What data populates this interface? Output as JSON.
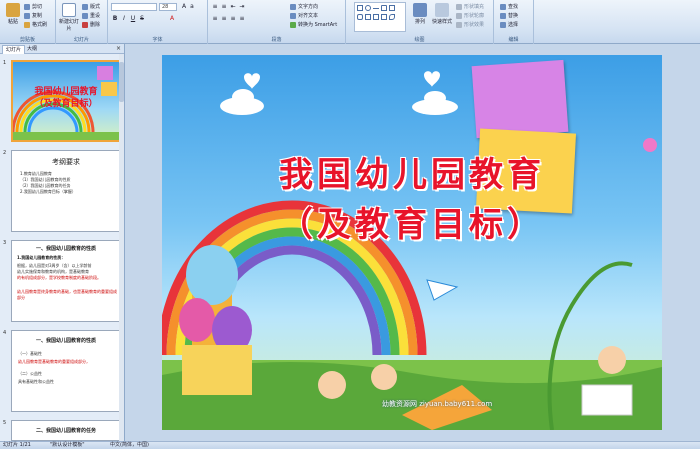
{
  "ribbon": {
    "groups": {
      "clipboard": "剪贴板",
      "slides": "幻灯片",
      "font": "字体",
      "paragraph": "段落",
      "drawing": "绘图",
      "editing": "编辑"
    },
    "paste": "粘贴",
    "cut": "剪切",
    "copy": "复制",
    "format_painter": "格式刷",
    "new_slide": "新建幻灯片",
    "layout": "版式",
    "reset": "重设",
    "delete": "删除",
    "font_size": "28",
    "text_direction": "文字方向",
    "align_text": "对齐文本",
    "convert_smartart": "转换为 SmartArt",
    "arrange": "排列",
    "quick_styles": "快速样式",
    "shape_fill": "形状填充",
    "shape_outline": "形状轮廓",
    "shape_effects": "形状效果",
    "find": "查找",
    "replace": "替换",
    "select": "选择"
  },
  "pane": {
    "tabs": [
      "幻灯片",
      "大纲"
    ],
    "close": "×",
    "thumbs": [
      {
        "num": "1",
        "title1": "我国幼儿园教育",
        "title2": "（及教育目标）"
      },
      {
        "num": "2",
        "heading": "考纲要求",
        "lines": [
          "1.教育幼儿园教育",
          "（1）我国幼儿园教育的性质",
          "（2）我国幼儿园教育的任务",
          "2.我国幼儿园教育目标（掌握）"
        ]
      },
      {
        "num": "3",
        "heading": "一、我国幼儿园教育的性质",
        "sub": "1.我国幼儿园教育的性质：",
        "lines": [
          "根据，幼儿园是对3周岁（含）以上学龄前",
          "幼儿实施保育和教育的机构，是基础教育",
          "的有机组成部分，是学校教育制度的基础阶段。",
          "幼儿园教育是终身教育的基础，也是基础教育的重要组成部分"
        ]
      },
      {
        "num": "4",
        "heading": "一、我国幼儿园教育的性质",
        "lines": [
          "（一）基础性",
          "（二）公益性",
          "幼儿园教育是基础教育的重要组成部分，",
          "具有基础性和公益性"
        ]
      },
      {
        "num": "5",
        "heading": "二、我国幼儿园教育的任务"
      }
    ]
  },
  "slide": {
    "title_line1": "我国幼儿园教育",
    "title_line2": "（及教育目标）",
    "watermark": "幼教资源网 ziyuan.baby611.com"
  },
  "status": {
    "slide_pos": "幻灯片 1/21",
    "theme": "\"默认设计模板\"",
    "lang": "中文(简体，中国)"
  },
  "colors": {
    "title_red": "#e8142a",
    "ribbon_bg": "#d5e3f3",
    "selected_border": "#f0a43a"
  }
}
